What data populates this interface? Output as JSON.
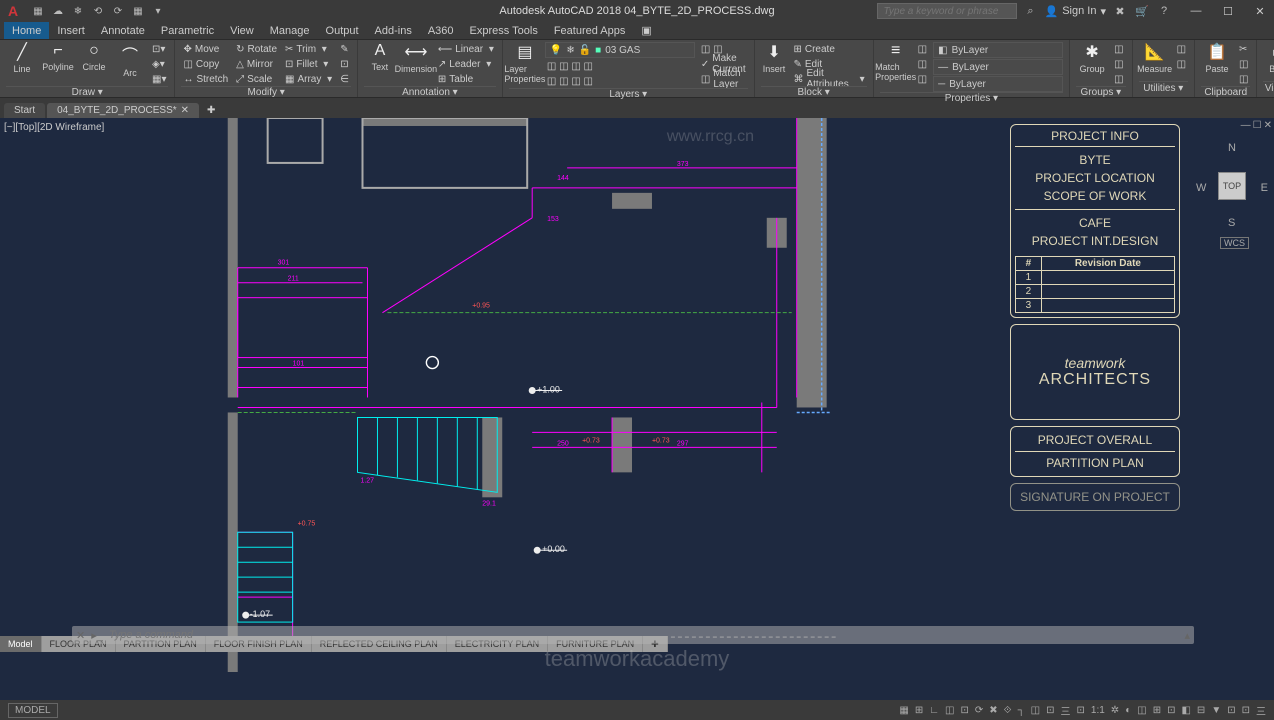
{
  "titlebar": {
    "app_logo": "A",
    "title": "Autodesk AutoCAD 2018   04_BYTE_2D_PROCESS.dwg",
    "search_placeholder": "Type a keyword or phrase",
    "signin": "Sign In"
  },
  "qat": [
    "▦",
    "☁",
    "❄",
    "⟲",
    "⟳",
    "▦",
    "▾"
  ],
  "menubar": [
    "Home",
    "Insert",
    "Annotate",
    "Parametric",
    "View",
    "Manage",
    "Output",
    "Add-ins",
    "A360",
    "Express Tools",
    "Featured Apps",
    "▣"
  ],
  "ribbon": {
    "draw": {
      "label": "Draw ▾",
      "big": [
        {
          "i": "╱",
          "t": "Line"
        },
        {
          "i": "◫",
          "t": "Polyline"
        },
        {
          "i": "○",
          "t": "Circle"
        },
        {
          "i": "⌒",
          "t": "Arc"
        }
      ]
    },
    "modify": {
      "label": "Modify ▾",
      "rows": [
        [
          "⊕",
          "Move"
        ],
        [
          "↻",
          "Rotate"
        ],
        [
          "✂",
          "Trim"
        ]
      ],
      "rows2": [
        [
          "◫",
          "Copy"
        ],
        [
          "△",
          "Mirror"
        ],
        [
          "⊡",
          "Fillet"
        ]
      ],
      "rows3": [
        [
          "↔",
          "Stretch"
        ],
        [
          "⤢",
          "Scale"
        ],
        [
          "▦",
          "Array"
        ]
      ]
    },
    "annotation": {
      "label": "Annotation ▾",
      "text": "Text",
      "dim": "Dimension",
      "items": [
        [
          "⟵",
          "Linear"
        ],
        [
          "↗",
          "Leader"
        ],
        [
          "⊞",
          "Table"
        ]
      ]
    },
    "layers": {
      "label": "Layers ▾",
      "lp": "Layer\nProperties",
      "current": "03 GAS",
      "items": [
        [
          "✓",
          "Make Current"
        ],
        [
          "◫",
          "Match Layer"
        ]
      ]
    },
    "block": {
      "label": "Block ▾",
      "insert": "Insert",
      "items": [
        [
          "⊞",
          "Create"
        ],
        [
          "✎",
          "Edit"
        ],
        [
          "⌘",
          "Edit Attributes"
        ]
      ]
    },
    "properties": {
      "label": "Properties ▾",
      "match": "Match\nProperties",
      "bylayer1": "ByLayer",
      "bylayer2": "ByLayer",
      "bylayer3": "ByLayer"
    },
    "groups": {
      "label": "Groups ▾",
      "group": "Group"
    },
    "utilities": {
      "label": "Utilities ▾",
      "measure": "Measure"
    },
    "clipboard": {
      "label": "Clipboard",
      "paste": "Paste"
    },
    "view": {
      "label": "View ▾",
      "base": "Base"
    }
  },
  "doctabs": {
    "start": "Start",
    "doc": "04_BYTE_2D_PROCESS*"
  },
  "viewport": {
    "label": "[−][Top][2D Wireframe]"
  },
  "viewcube": {
    "top": "TOP",
    "n": "N",
    "e": "E",
    "s": "S",
    "w": "W",
    "wcs": "WCS"
  },
  "info": {
    "header": "PROJECT INFO",
    "line1": "BYTE",
    "line2": "PROJECT LOCATION",
    "line3": "SCOPE OF WORK",
    "line4": "CAFE",
    "line5": "PROJECT INT.DESIGN",
    "rev_h1": "#",
    "rev_h2": "Revision Date",
    "rows": [
      "1",
      "2",
      "3"
    ],
    "tw1": "teamwork",
    "tw2": "ARCHITECTS",
    "overall": "PROJECT OVERALL",
    "partition": "PARTITION PLAN",
    "sig": "SIGNATURE ON PROJECT"
  },
  "cmd": {
    "placeholder": "Type a command"
  },
  "layout_tabs": [
    "Model",
    "FLOOR PLAN",
    "PARTITION PLAN",
    "FLOOR FINISH PLAN",
    "REFLECTED CEILING PLAN",
    "ELECTRICITY PLAN",
    "FURNITURE PLAN"
  ],
  "statusbar": {
    "model": "MODEL",
    "items": [
      "▦",
      "⊞",
      "∟",
      "◫",
      "⊡",
      "⟳",
      "✖",
      "⟐",
      "┐",
      "◫",
      "⊡",
      "三",
      "⊡",
      "1:1",
      "✲",
      "◐",
      "◫",
      "⊞",
      "⊡",
      "◧",
      "⊟",
      "▼",
      "⊡",
      "⊡",
      "三"
    ]
  },
  "drawing_labels": {
    "d301": "301",
    "d211": "211",
    "d101": "101",
    "d144": "144",
    "d373": "373",
    "d153": "153",
    "d250": "250",
    "d297": "297",
    "d127": "1.27",
    "d29": "29.1",
    "p100": "+1.00",
    "p000": "+0.00",
    "n107": "-1.07",
    "a73": "+0.73",
    "a95": "+0.95",
    "a075": "+0.75"
  },
  "watermarks": {
    "bottom": "teamworkacademy",
    "top": "www.rrcg.cn"
  }
}
